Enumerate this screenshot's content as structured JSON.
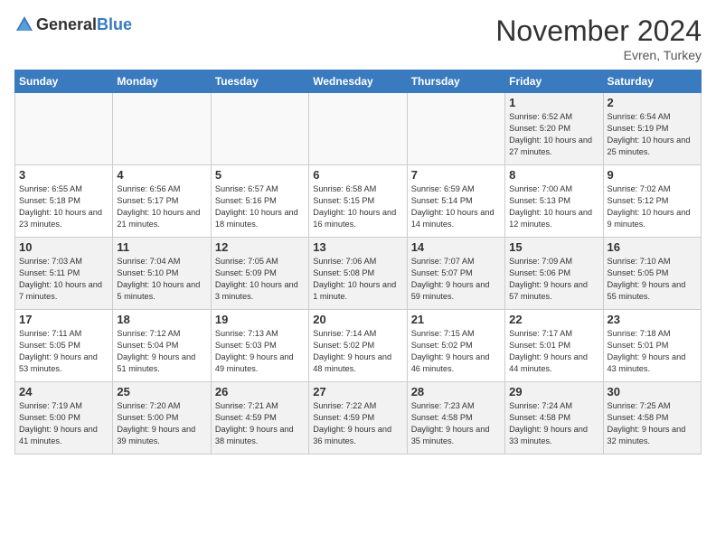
{
  "logo": {
    "general": "General",
    "blue": "Blue"
  },
  "title": "November 2024",
  "location": "Evren, Turkey",
  "weekdays": [
    "Sunday",
    "Monday",
    "Tuesday",
    "Wednesday",
    "Thursday",
    "Friday",
    "Saturday"
  ],
  "weeks": [
    [
      {
        "day": "",
        "content": ""
      },
      {
        "day": "",
        "content": ""
      },
      {
        "day": "",
        "content": ""
      },
      {
        "day": "",
        "content": ""
      },
      {
        "day": "",
        "content": ""
      },
      {
        "day": "1",
        "content": "Sunrise: 6:52 AM\nSunset: 5:20 PM\nDaylight: 10 hours and 27 minutes."
      },
      {
        "day": "2",
        "content": "Sunrise: 6:54 AM\nSunset: 5:19 PM\nDaylight: 10 hours and 25 minutes."
      }
    ],
    [
      {
        "day": "3",
        "content": "Sunrise: 6:55 AM\nSunset: 5:18 PM\nDaylight: 10 hours and 23 minutes."
      },
      {
        "day": "4",
        "content": "Sunrise: 6:56 AM\nSunset: 5:17 PM\nDaylight: 10 hours and 21 minutes."
      },
      {
        "day": "5",
        "content": "Sunrise: 6:57 AM\nSunset: 5:16 PM\nDaylight: 10 hours and 18 minutes."
      },
      {
        "day": "6",
        "content": "Sunrise: 6:58 AM\nSunset: 5:15 PM\nDaylight: 10 hours and 16 minutes."
      },
      {
        "day": "7",
        "content": "Sunrise: 6:59 AM\nSunset: 5:14 PM\nDaylight: 10 hours and 14 minutes."
      },
      {
        "day": "8",
        "content": "Sunrise: 7:00 AM\nSunset: 5:13 PM\nDaylight: 10 hours and 12 minutes."
      },
      {
        "day": "9",
        "content": "Sunrise: 7:02 AM\nSunset: 5:12 PM\nDaylight: 10 hours and 9 minutes."
      }
    ],
    [
      {
        "day": "10",
        "content": "Sunrise: 7:03 AM\nSunset: 5:11 PM\nDaylight: 10 hours and 7 minutes."
      },
      {
        "day": "11",
        "content": "Sunrise: 7:04 AM\nSunset: 5:10 PM\nDaylight: 10 hours and 5 minutes."
      },
      {
        "day": "12",
        "content": "Sunrise: 7:05 AM\nSunset: 5:09 PM\nDaylight: 10 hours and 3 minutes."
      },
      {
        "day": "13",
        "content": "Sunrise: 7:06 AM\nSunset: 5:08 PM\nDaylight: 10 hours and 1 minute."
      },
      {
        "day": "14",
        "content": "Sunrise: 7:07 AM\nSunset: 5:07 PM\nDaylight: 9 hours and 59 minutes."
      },
      {
        "day": "15",
        "content": "Sunrise: 7:09 AM\nSunset: 5:06 PM\nDaylight: 9 hours and 57 minutes."
      },
      {
        "day": "16",
        "content": "Sunrise: 7:10 AM\nSunset: 5:05 PM\nDaylight: 9 hours and 55 minutes."
      }
    ],
    [
      {
        "day": "17",
        "content": "Sunrise: 7:11 AM\nSunset: 5:05 PM\nDaylight: 9 hours and 53 minutes."
      },
      {
        "day": "18",
        "content": "Sunrise: 7:12 AM\nSunset: 5:04 PM\nDaylight: 9 hours and 51 minutes."
      },
      {
        "day": "19",
        "content": "Sunrise: 7:13 AM\nSunset: 5:03 PM\nDaylight: 9 hours and 49 minutes."
      },
      {
        "day": "20",
        "content": "Sunrise: 7:14 AM\nSunset: 5:02 PM\nDaylight: 9 hours and 48 minutes."
      },
      {
        "day": "21",
        "content": "Sunrise: 7:15 AM\nSunset: 5:02 PM\nDaylight: 9 hours and 46 minutes."
      },
      {
        "day": "22",
        "content": "Sunrise: 7:17 AM\nSunset: 5:01 PM\nDaylight: 9 hours and 44 minutes."
      },
      {
        "day": "23",
        "content": "Sunrise: 7:18 AM\nSunset: 5:01 PM\nDaylight: 9 hours and 43 minutes."
      }
    ],
    [
      {
        "day": "24",
        "content": "Sunrise: 7:19 AM\nSunset: 5:00 PM\nDaylight: 9 hours and 41 minutes."
      },
      {
        "day": "25",
        "content": "Sunrise: 7:20 AM\nSunset: 5:00 PM\nDaylight: 9 hours and 39 minutes."
      },
      {
        "day": "26",
        "content": "Sunrise: 7:21 AM\nSunset: 4:59 PM\nDaylight: 9 hours and 38 minutes."
      },
      {
        "day": "27",
        "content": "Sunrise: 7:22 AM\nSunset: 4:59 PM\nDaylight: 9 hours and 36 minutes."
      },
      {
        "day": "28",
        "content": "Sunrise: 7:23 AM\nSunset: 4:58 PM\nDaylight: 9 hours and 35 minutes."
      },
      {
        "day": "29",
        "content": "Sunrise: 7:24 AM\nSunset: 4:58 PM\nDaylight: 9 hours and 33 minutes."
      },
      {
        "day": "30",
        "content": "Sunrise: 7:25 AM\nSunset: 4:58 PM\nDaylight: 9 hours and 32 minutes."
      }
    ]
  ]
}
